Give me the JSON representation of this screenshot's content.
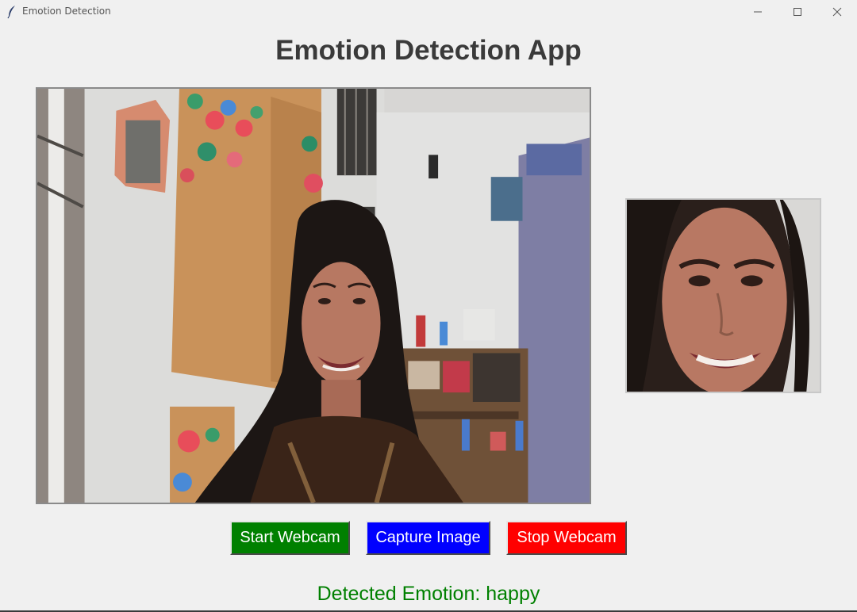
{
  "window": {
    "title": "Emotion Detection",
    "controls": [
      "minimize",
      "maximize",
      "close"
    ]
  },
  "app": {
    "heading": "Emotion Detection App",
    "title_color": "#3a3a3a"
  },
  "buttons": {
    "start_label": "Start Webcam",
    "capture_label": "Capture Image",
    "stop_label": "Stop Webcam",
    "start_color": "#008000",
    "capture_color": "#0000ff",
    "stop_color": "#ff0000"
  },
  "result": {
    "text": "Detected Emotion: happy",
    "color": "#008000"
  },
  "icons": {
    "app": "feather-icon",
    "minimize": "minimize-icon",
    "maximize": "maximize-icon",
    "close": "close-icon"
  }
}
